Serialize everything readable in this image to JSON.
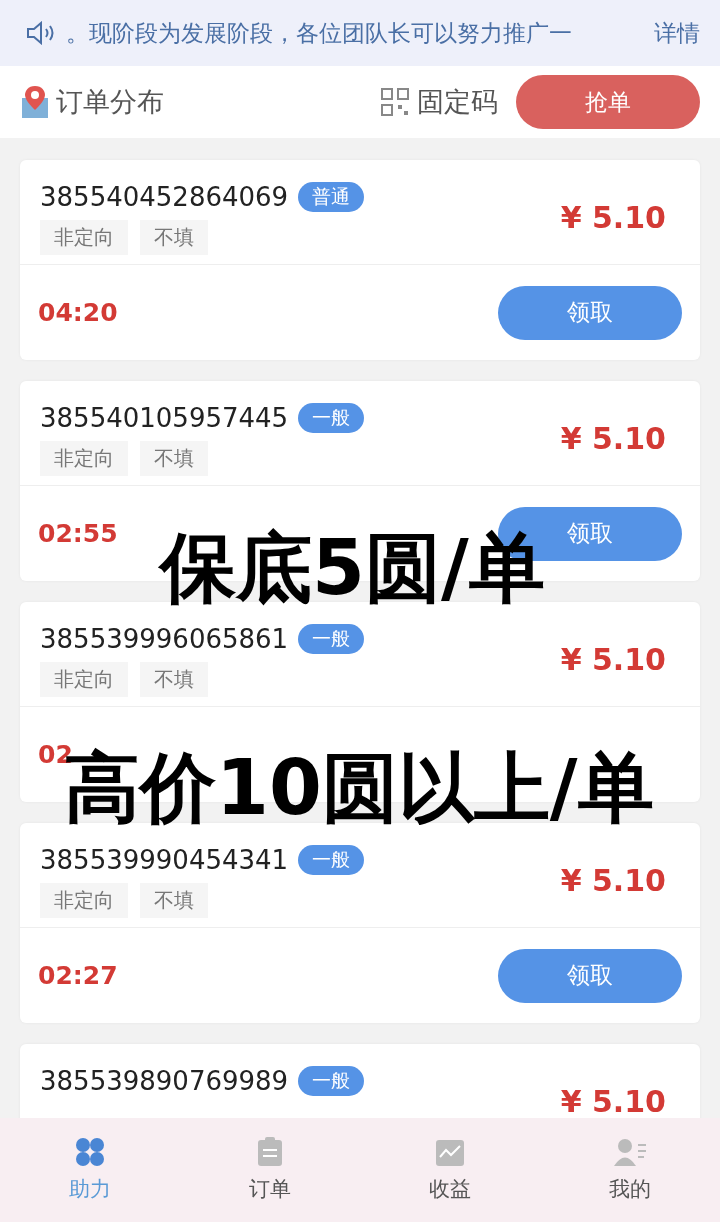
{
  "notice": {
    "text": "。现阶段为发展阶段，各位团队长可以努力推广一",
    "link": "详情"
  },
  "header": {
    "title": "订单分布",
    "code_label": "固定码",
    "grab_button": "抢单"
  },
  "orders": [
    {
      "id": "385540452864069",
      "badge": "普通",
      "tags": [
        "非定向",
        "不填"
      ],
      "price": "¥ 5.10",
      "time": "04:20",
      "button": "领取"
    },
    {
      "id": "385540105957445",
      "badge": "一般",
      "tags": [
        "非定向",
        "不填"
      ],
      "price": "¥ 5.10",
      "time": "02:55",
      "button": "领取"
    },
    {
      "id": "385539996065861",
      "badge": "一般",
      "tags": [
        "非定向",
        "不填"
      ],
      "price": "¥ 5.10",
      "time": "02"
    },
    {
      "id": "385539990454341",
      "badge": "一般",
      "tags": [
        "非定向",
        "不填"
      ],
      "price": "¥ 5.10",
      "time": "02:27",
      "button": "领取"
    },
    {
      "id": "385539890769989",
      "badge": "一般",
      "price": "¥ 5.10"
    }
  ],
  "overlay_texts": [
    "保底5圆/单",
    "高价10圆以上/单"
  ],
  "tabbar": [
    {
      "label": "助力",
      "kind": "grid",
      "selected": true
    },
    {
      "label": "订单",
      "kind": "clipboard",
      "selected": false
    },
    {
      "label": "收益",
      "kind": "chart",
      "selected": false
    },
    {
      "label": "我的",
      "kind": "user",
      "selected": false
    }
  ]
}
